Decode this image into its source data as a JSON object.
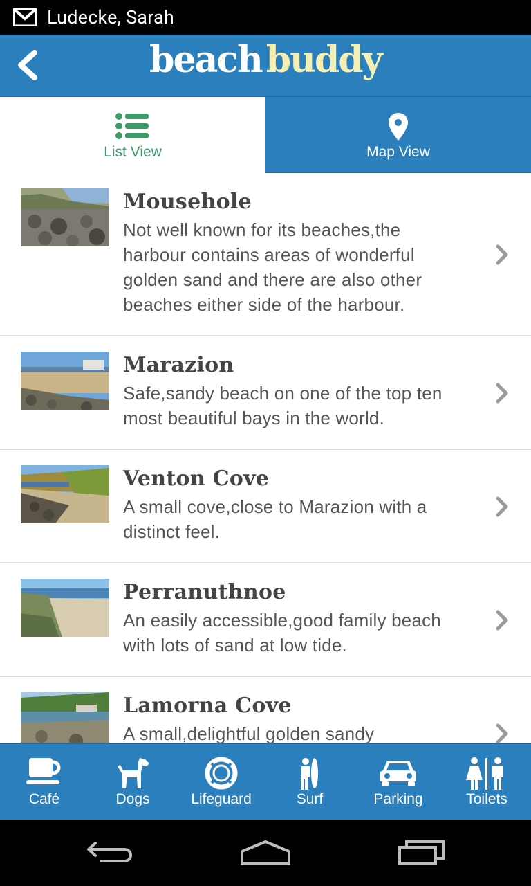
{
  "status_bar": {
    "notification_icon": "gmail-icon",
    "account": "Ludecke, Sarah"
  },
  "app_bar": {
    "back_icon": "chevron-left-icon",
    "logo_part1": "beach",
    "logo_part2": "buddy"
  },
  "tabs": [
    {
      "label": "List View",
      "icon": "list-icon",
      "active": true
    },
    {
      "label": "Map View",
      "icon": "map-pin-icon",
      "active": false
    }
  ],
  "beaches": [
    {
      "name": "Mousehole",
      "description": "Not well known for its beaches,the harbour contains areas of wonderful golden sand and there are also other beaches either side of the harbour."
    },
    {
      "name": "Marazion",
      "description": "Safe,sandy beach on one of the top ten most beautiful bays in the world."
    },
    {
      "name": "Venton Cove",
      "description": "A small cove,close to Marazion with a distinct feel."
    },
    {
      "name": "Perranuthnoe",
      "description": "An easily accessible,good family beach with lots of sand at low tide."
    },
    {
      "name": "Lamorna Cove",
      "description": "A small,delightful golden sandy"
    }
  ],
  "filters": [
    {
      "label": "Café",
      "icon": "cup-icon"
    },
    {
      "label": "Dogs",
      "icon": "dog-icon"
    },
    {
      "label": "Lifeguard",
      "icon": "lifebuoy-icon"
    },
    {
      "label": "Surf",
      "icon": "surfer-icon"
    },
    {
      "label": "Parking",
      "icon": "car-icon"
    },
    {
      "label": "Toilets",
      "icon": "toilets-icon"
    }
  ],
  "colors": {
    "brand_blue": "#2a7fbc",
    "active_tab_green": "#3c9a6b",
    "logo_yellow": "#f4efb2",
    "title_text": "#444444"
  }
}
